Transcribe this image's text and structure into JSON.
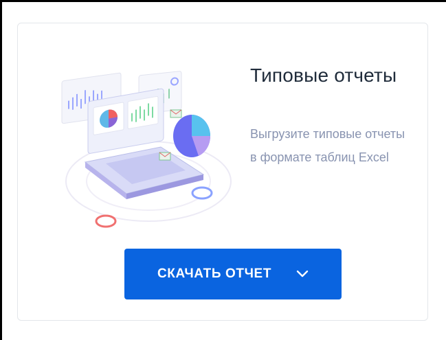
{
  "card": {
    "title": "Типовые отчеты",
    "description": "Выгрузите типовые отчеты в формате таблиц Excel",
    "download_label": "СКАЧАТЬ ОТЧЕТ"
  },
  "icons": {
    "illustration": "laptop-reports-illustration",
    "dropdown": "chevron-down-icon"
  },
  "colors": {
    "accent": "#0a64e0",
    "title": "#1f2b3a",
    "description": "#8893b0"
  }
}
